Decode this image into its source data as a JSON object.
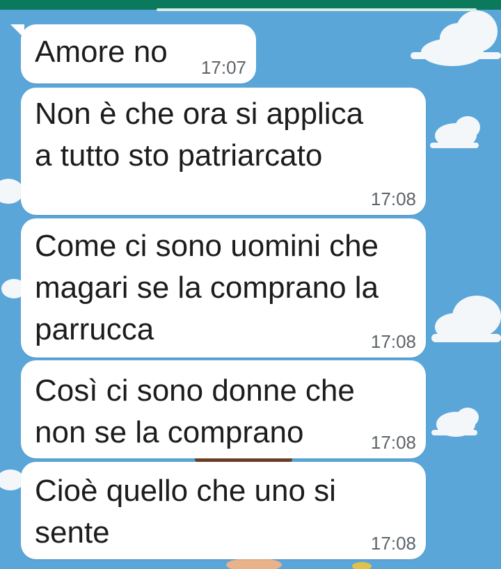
{
  "chat": {
    "wallpaper": {
      "sky_color": "#5aa6d9",
      "cloud_color": "#f4f7f9",
      "top_bar_color": "#0b7a5c"
    },
    "messages": [
      {
        "text": "Amore no",
        "time": "17:07"
      },
      {
        "text": "Non è che ora si applica\na tutto sto patriarcato",
        "time": "17:08"
      },
      {
        "text": "Come ci sono uomini che\nmagari se la comprano la\nparrucca",
        "time": "17:08"
      },
      {
        "text": "Così ci sono donne che\nnon se la comprano",
        "time": "17:08"
      },
      {
        "text": "Cioè quello che uno si\nsente",
        "time": "17:08"
      }
    ]
  }
}
